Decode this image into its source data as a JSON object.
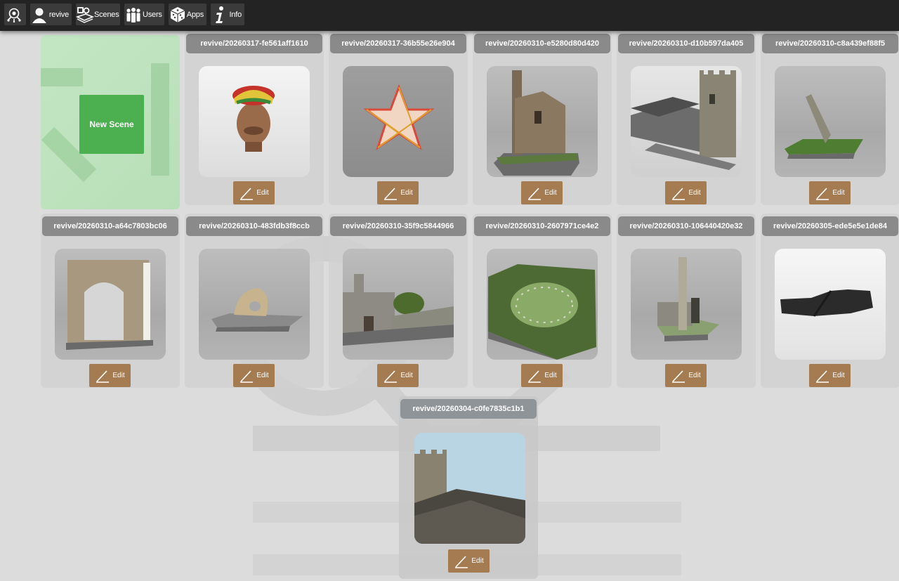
{
  "nav": {
    "home_icon": "home-logo-icon",
    "user_label": "revive",
    "scenes_label": "Scenes",
    "users_label": "Users",
    "apps_label": "Apps",
    "info_label": "Info"
  },
  "new_scene": {
    "label": "New Scene"
  },
  "edit_label": "Edit",
  "scenes": [
    {
      "title": "revive/20260317-fe561aff1610",
      "icon": "head-sculpture"
    },
    {
      "title": "revive/20260317-36b55e26e904",
      "icon": "star-model"
    },
    {
      "title": "revive/20260310-e5280d80d420",
      "icon": "engine-house"
    },
    {
      "title": "revive/20260310-d10b597da405",
      "icon": "church-tower"
    },
    {
      "title": "revive/20260310-c8a439ef88f5",
      "icon": "standing-stone"
    },
    {
      "title": "revive/20260310-a64c7803bc06",
      "icon": "stone-arch"
    },
    {
      "title": "revive/20260310-483fdb3f8ccb",
      "icon": "holed-rock"
    },
    {
      "title": "revive/20260310-35f9c5844966",
      "icon": "chapel"
    },
    {
      "title": "revive/20260310-2607971ce4e2",
      "icon": "stone-circle"
    },
    {
      "title": "revive/20260310-106440420e32",
      "icon": "pillar-stone"
    },
    {
      "title": "revive/20260305-ede5e5e1de84",
      "icon": "dark-log"
    },
    {
      "title": "revive/20260304-c0fe7835c1b1",
      "icon": "tower-roof-photo"
    }
  ],
  "colors": {
    "topbar": "#232323",
    "nav_button": "#3b3b3b",
    "card_title": "#8a8a8a",
    "edit_button": "#a57c52",
    "new_scene_button": "#4caf50"
  }
}
